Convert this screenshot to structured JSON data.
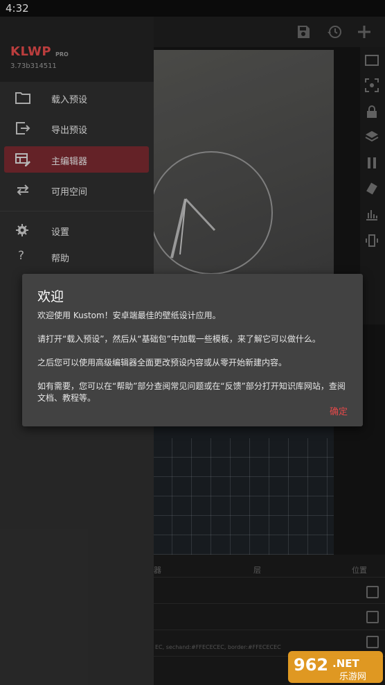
{
  "status_bar": {
    "time": "4:32"
  },
  "drawer": {
    "brand": "KLWP",
    "brand_badge": "PRO",
    "version": "3.73b314511",
    "items": [
      {
        "label": "载入预设",
        "icon": "folder-icon"
      },
      {
        "label": "导出预设",
        "icon": "export-icon"
      },
      {
        "label": "主编辑器",
        "icon": "editor-icon",
        "active": true
      },
      {
        "label": "可用空间",
        "icon": "swap-icon"
      },
      {
        "label": "设置",
        "icon": "gear-icon"
      },
      {
        "label": "帮助",
        "icon": "help-icon"
      }
    ]
  },
  "dialog": {
    "title": "欢迎",
    "paragraphs": [
      "欢迎使用 Kustom！安卓端最佳的壁纸设计应用。",
      "请打开“载入预设”，然后从“基础包”中加载一些模板，来了解它可以做什么。",
      "之后您可以使用高级编辑器全面更改预设内容或从零开始新建内容。",
      "如有需要，您可以在“帮助”部分查阅常见问题或在“反馈”部分打开知识库网站，查阅文档、教程等。"
    ],
    "ok_label": "确定"
  },
  "editor": {
    "tab_layer_partial": "器",
    "tab_layer": "层",
    "tab_position": "位置",
    "snippet_text": "EC, sechand:#FFECECEC, border:#FFECECEC"
  },
  "watermark": {
    "number": "962",
    "domain": ".NET",
    "site": "乐游网"
  },
  "colors": {
    "accent": "#e34b4b",
    "active_item_bg": "#7a2a30",
    "dialog_bg": "#424242"
  }
}
